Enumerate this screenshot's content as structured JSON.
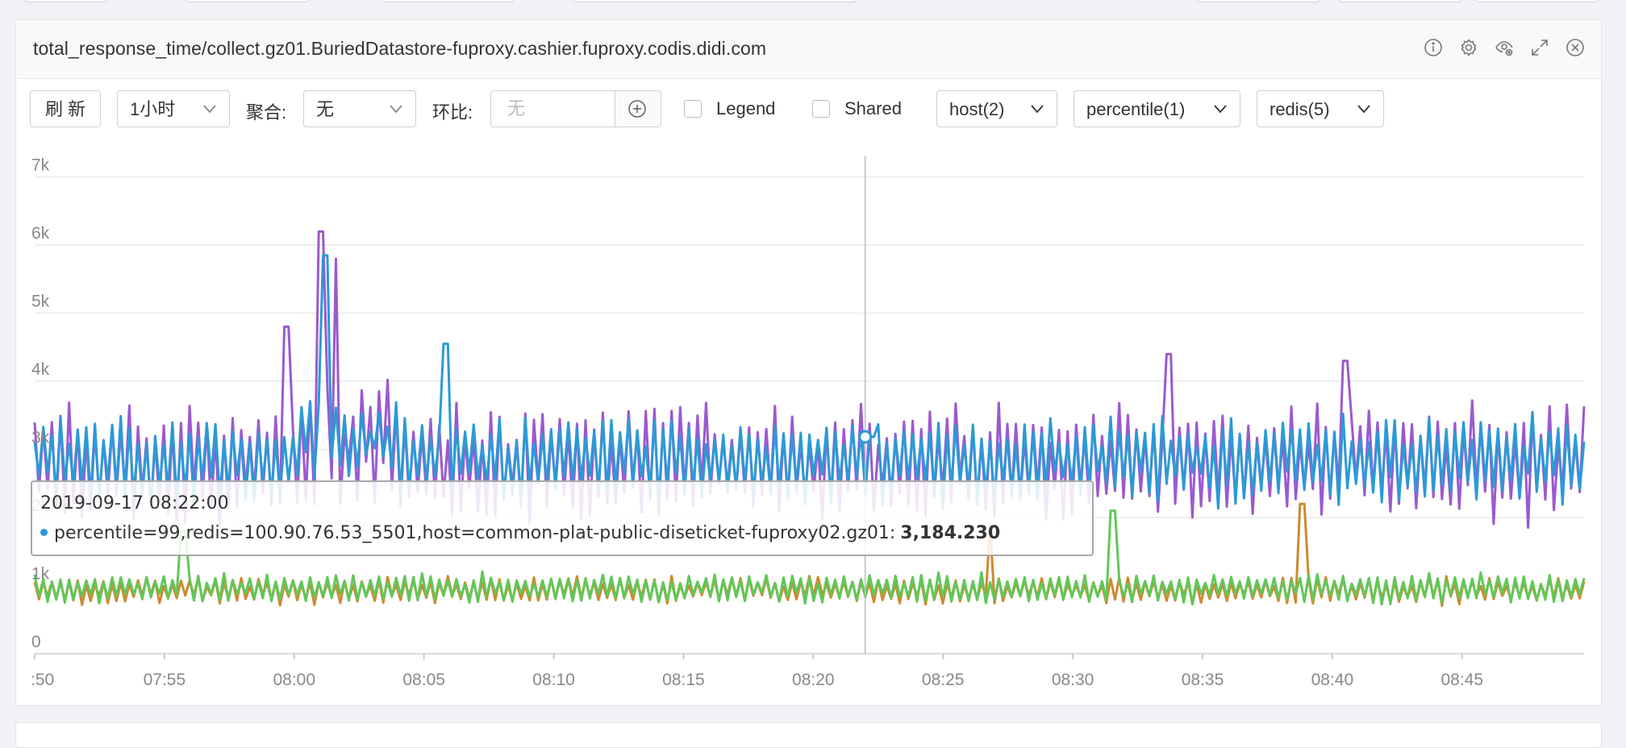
{
  "panel": {
    "title": "total_response_time/collect.gz01.BuriedDatastore-fuproxy.cashier.fuproxy.codis.didi.com",
    "icons": [
      "info-icon",
      "gear-icon",
      "eye-settings-icon",
      "expand-icon",
      "close-icon"
    ]
  },
  "toolbar": {
    "refresh_label": "刷 新",
    "time_range": "1小时",
    "aggregate_label": "聚合:",
    "aggregate_value": "无",
    "compare_label": "环比:",
    "compare_placeholder": "无",
    "legend_label": "Legend",
    "legend_checked": false,
    "shared_label": "Shared",
    "shared_checked": false,
    "tag_host": "host(2)",
    "tag_percentile": "percentile(1)",
    "tag_redis": "redis(5)"
  },
  "tooltip": {
    "time": "2019-09-17 08:22:00",
    "series": "percentile=99,redis=100.90.76.53_5501,host=common-plat-public-diseticket-fuproxy02.gz01:",
    "value": "3,184.230"
  },
  "colors": {
    "purple": "#9b59cf",
    "blue": "#2b9ad6",
    "orange": "#cd8a2f",
    "green": "#62c659",
    "grid": "#e9e9e9",
    "axis_text": "#888888"
  },
  "chart_data": {
    "type": "line",
    "y_ticks": [
      "0",
      "1k",
      "2k",
      "3k",
      "4k",
      "5k",
      "6k",
      "7k"
    ],
    "x_ticks": [
      ":50",
      "07:55",
      "08:00",
      "08:05",
      "08:10",
      "08:15",
      "08:20",
      "08:25",
      "08:30",
      "08:35",
      "08:40",
      "08:45"
    ],
    "ylim": [
      0,
      7350
    ],
    "x_range_minutes": [
      -10,
      49.7
    ],
    "cursor_minute": 22,
    "series": [
      {
        "color": "purple",
        "base": 2800,
        "amp": 1000,
        "peaks": [
          [
            1.0,
            6200
          ],
          [
            1.6,
            5800
          ],
          [
            -0.3,
            4800
          ],
          [
            33.7,
            4400
          ],
          [
            40.5,
            4300
          ]
        ]
      },
      {
        "color": "blue",
        "base": 2850,
        "amp": 750,
        "peaks": [
          [
            1.2,
            5850
          ],
          [
            5.9,
            4550
          ],
          [
            22.2,
            3184
          ]
        ]
      },
      {
        "color": "orange",
        "base": 930,
        "amp": 230,
        "peaks": [
          [
            38.8,
            2200
          ],
          [
            26.8,
            1900
          ]
        ]
      },
      {
        "color": "green",
        "base": 960,
        "amp": 260,
        "peaks": [
          [
            31.5,
            2100
          ],
          [
            -4.3,
            1800
          ]
        ]
      }
    ]
  }
}
